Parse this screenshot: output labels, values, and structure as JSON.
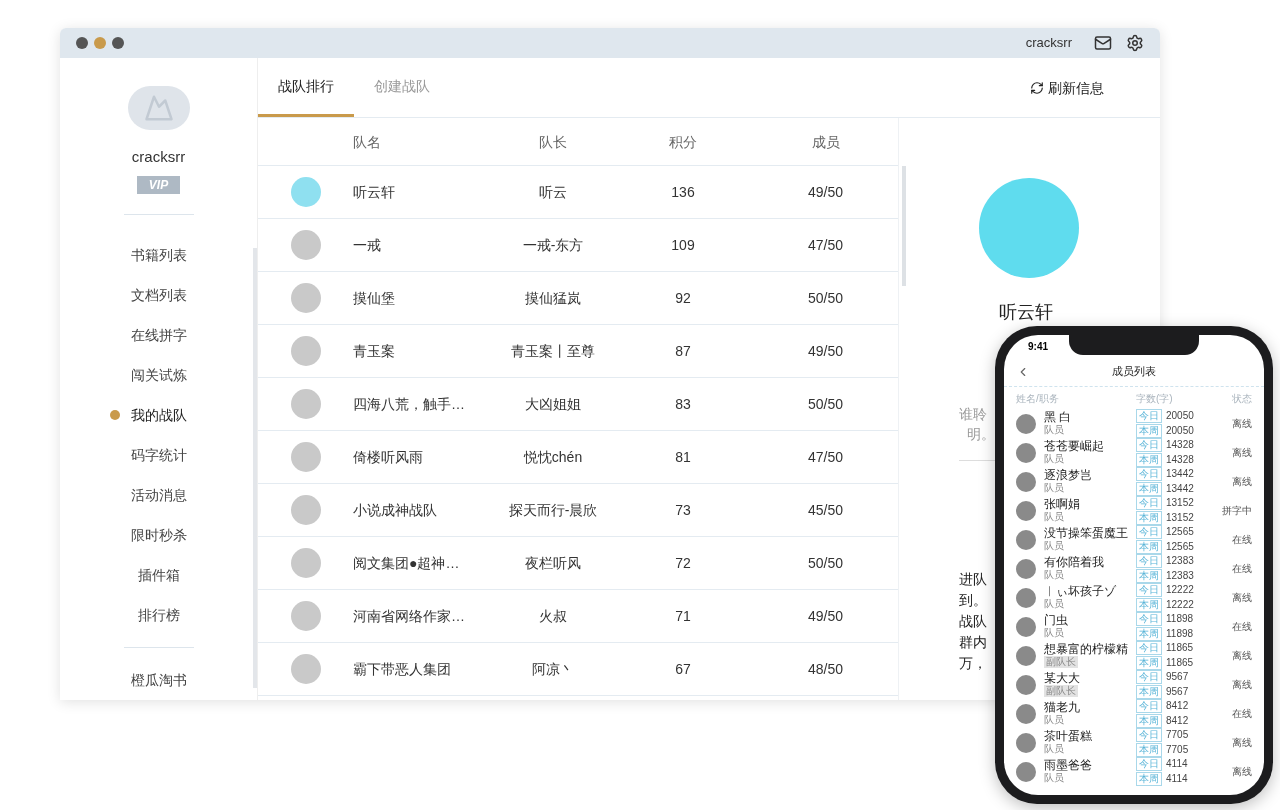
{
  "window": {
    "username": "cracksrr"
  },
  "sidebar": {
    "username": "cracksrr",
    "badge": "VIP",
    "items": [
      {
        "label": "书籍列表",
        "selected": false
      },
      {
        "label": "文档列表",
        "selected": false
      },
      {
        "label": "在线拼字",
        "selected": false
      },
      {
        "label": "闯关试炼",
        "selected": false
      },
      {
        "label": "我的战队",
        "selected": true
      },
      {
        "label": "码字统计",
        "selected": false
      },
      {
        "label": "活动消息",
        "selected": false
      },
      {
        "label": "限时秒杀",
        "selected": false
      },
      {
        "label": "插件箱",
        "selected": false
      },
      {
        "label": "排行榜",
        "selected": false
      }
    ],
    "footer_items": [
      {
        "label": "橙瓜淘书",
        "selected": false
      }
    ]
  },
  "tabs": [
    {
      "label": "战队排行",
      "selected": true
    },
    {
      "label": "创建战队",
      "selected": false
    }
  ],
  "refresh_button": "刷新信息",
  "table": {
    "columns": [
      "队名",
      "队长",
      "积分",
      "成员"
    ],
    "rows": [
      {
        "name": "听云轩",
        "leader": "听云",
        "score": "136",
        "members": "49/50"
      },
      {
        "name": "一戒",
        "leader": "一戒-东方",
        "score": "109",
        "members": "47/50"
      },
      {
        "name": "摸仙堡",
        "leader": "摸仙猛岚",
        "score": "92",
        "members": "50/50"
      },
      {
        "name": "青玉案",
        "leader": "青玉案丨至尊",
        "score": "87",
        "members": "49/50"
      },
      {
        "name": "四海八荒，触手…",
        "leader": "大凶姐姐",
        "score": "83",
        "members": "50/50"
      },
      {
        "name": "倚楼听风雨",
        "leader": "悦忱chén",
        "score": "81",
        "members": "47/50"
      },
      {
        "name": "小说成神战队",
        "leader": "探天而行-晨欣",
        "score": "73",
        "members": "45/50"
      },
      {
        "name": "阅文集团●超神…",
        "leader": "夜栏听风",
        "score": "72",
        "members": "50/50"
      },
      {
        "name": "河南省网络作家…",
        "leader": "火叔",
        "score": "71",
        "members": "49/50"
      },
      {
        "name": "霸下带恶人集团",
        "leader": "阿凉丶",
        "score": "67",
        "members": "48/50"
      }
    ]
  },
  "detail": {
    "title": "听云轩",
    "description_lines": [
      "谁聆",
      "明。"
    ],
    "notes": [
      "进队",
      "到。",
      "战队",
      "群内",
      "万，"
    ]
  },
  "phone": {
    "time": "9:41",
    "title": "成员列表",
    "columns": [
      "姓名/职务",
      "字数(字)",
      "状态"
    ],
    "members": [
      {
        "name": "黑 白",
        "role": "队员",
        "role_highlighted": false,
        "today_tag": "今日",
        "today": "20050",
        "week_tag": "本周",
        "week": "20050",
        "status": "离线"
      },
      {
        "name": "苍苍要崛起",
        "role": "队员",
        "role_highlighted": false,
        "today_tag": "今日",
        "today": "14328",
        "week_tag": "本周",
        "week": "14328",
        "status": "离线"
      },
      {
        "name": "逐浪梦岂",
        "role": "队员",
        "role_highlighted": false,
        "today_tag": "今日",
        "today": "13442",
        "week_tag": "本周",
        "week": "13442",
        "status": "离线"
      },
      {
        "name": "张啊娟",
        "role": "队员",
        "role_highlighted": false,
        "today_tag": "今日",
        "today": "13152",
        "week_tag": "本周",
        "week": "13152",
        "status": "拼字中"
      },
      {
        "name": "没节操笨蛋魔王",
        "role": "队员",
        "role_highlighted": false,
        "today_tag": "今日",
        "today": "12565",
        "week_tag": "本周",
        "week": "12565",
        "status": "在线"
      },
      {
        "name": "有你陪着我",
        "role": "队员",
        "role_highlighted": false,
        "today_tag": "今日",
        "today": "12383",
        "week_tag": "本周",
        "week": "12383",
        "status": "在线"
      },
      {
        "name": "︱ぃ坏孩子ゾ",
        "role": "队员",
        "role_highlighted": false,
        "today_tag": "今日",
        "today": "12222",
        "week_tag": "本周",
        "week": "12222",
        "status": "离线"
      },
      {
        "name": "门虫",
        "role": "队员",
        "role_highlighted": false,
        "today_tag": "今日",
        "today": "11898",
        "week_tag": "本周",
        "week": "11898",
        "status": "在线"
      },
      {
        "name": "想暴富的柠檬精",
        "role": "副队长",
        "role_highlighted": true,
        "today_tag": "今日",
        "today": "11865",
        "week_tag": "本周",
        "week": "11865",
        "status": "离线"
      },
      {
        "name": "某大大",
        "role": "副队长",
        "role_highlighted": true,
        "today_tag": "今日",
        "today": "9567",
        "week_tag": "本周",
        "week": "9567",
        "status": "离线"
      },
      {
        "name": "猫老九",
        "role": "队员",
        "role_highlighted": false,
        "today_tag": "今日",
        "today": "8412",
        "week_tag": "本周",
        "week": "8412",
        "status": "在线"
      },
      {
        "name": "茶叶蛋糕",
        "role": "队员",
        "role_highlighted": false,
        "today_tag": "今日",
        "today": "7705",
        "week_tag": "本周",
        "week": "7705",
        "status": "离线"
      },
      {
        "name": "雨墨爸爸",
        "role": "队员",
        "role_highlighted": false,
        "today_tag": "今日",
        "today": "4114",
        "week_tag": "本周",
        "week": "4114",
        "status": "离线"
      }
    ]
  }
}
